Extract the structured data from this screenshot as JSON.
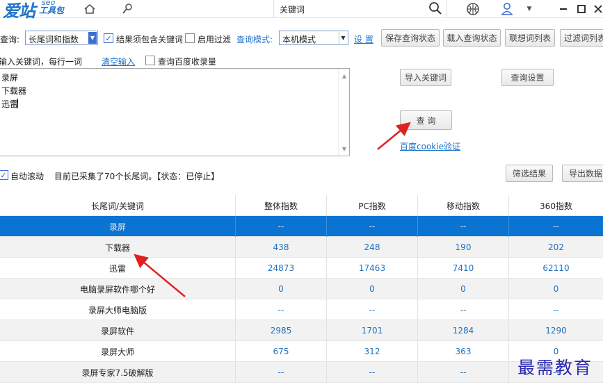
{
  "app": {
    "logo_main": "爱站",
    "logo_seo": "seo",
    "logo_sub": "工具包",
    "search_value": "关键词",
    "colors": {
      "accent": "#1e73c8",
      "selected_row": "#0b73d1",
      "arrow": "#e02020",
      "watermark": "#2a2ab0"
    }
  },
  "toolbar": {
    "query_label": "查询:",
    "query_type": "长尾词和指数",
    "chk_contains_label": "结果须包含关键词",
    "chk_contains_checked": true,
    "chk_filter_label": "启用过滤",
    "chk_filter_checked": false,
    "mode_label": "查询模式:",
    "mode_value": "本机模式",
    "settings_link": "设 置",
    "save_state": "保存查询状态",
    "load_state": "载入查询状态",
    "assoc_list": "联想词列表",
    "filter_list": "过滤词列表"
  },
  "input": {
    "hint": "输入关键词，每行一词",
    "clear_link": "清空输入",
    "baidu_index_label": "查询百度收录量",
    "baidu_index_checked": false,
    "lines": [
      "录屏",
      "下载器",
      "迅雷"
    ],
    "import_button": "导入关键词",
    "query_settings_button": "查询设置",
    "query_button": "查 询",
    "cookie_link": "百度cookie验证"
  },
  "status": {
    "auto_scroll_label": "自动滚动",
    "auto_scroll_checked": true,
    "message": "目前已采集了70个长尾词。【状态：已停止】",
    "filter_results": "筛选结果",
    "export_data": "导出数据"
  },
  "table": {
    "headers": [
      "长尾词/关键词",
      "整体指数",
      "PC指数",
      "移动指数",
      "360指数"
    ],
    "rows": [
      {
        "kw": "录屏",
        "total": "--",
        "pc": "--",
        "mobile": "--",
        "s360": "--"
      },
      {
        "kw": "下载器",
        "total": "438",
        "pc": "248",
        "mobile": "190",
        "s360": "202"
      },
      {
        "kw": "迅雷",
        "total": "24873",
        "pc": "17463",
        "mobile": "7410",
        "s360": "62110"
      },
      {
        "kw": "电脑录屏软件哪个好",
        "total": "0",
        "pc": "0",
        "mobile": "0",
        "s360": "0"
      },
      {
        "kw": "录屏大师电脑版",
        "total": "--",
        "pc": "--",
        "mobile": "--",
        "s360": "--"
      },
      {
        "kw": "录屏软件",
        "total": "2985",
        "pc": "1701",
        "mobile": "1284",
        "s360": "1290"
      },
      {
        "kw": "录屏大师",
        "total": "675",
        "pc": "312",
        "mobile": "363",
        "s360": "0"
      },
      {
        "kw": "录屏专家7.5破解版",
        "total": "--",
        "pc": "--",
        "mobile": "--",
        "s360": "--"
      }
    ]
  },
  "watermark": "最需教育"
}
